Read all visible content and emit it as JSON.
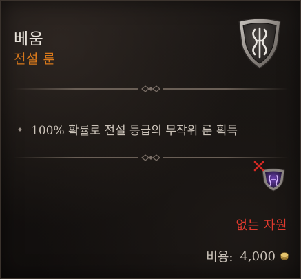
{
  "item": {
    "name": "베움",
    "type": "전설 룬",
    "effect": "100% 확률로 전설 등급의 무작위 룬 획득"
  },
  "requirement": {
    "status": "없는 자원"
  },
  "cost": {
    "label": "비용:",
    "value": "4,000",
    "currency_icon": "gold-coin-icon"
  },
  "icons": {
    "rune": "rune-shield-icon",
    "socket": "socket-unavailable-icon"
  },
  "colors": {
    "legendary": "#d9791b",
    "unavailable": "#e13a2e",
    "title": "#e9e3db",
    "text": "#cbc3b9"
  }
}
